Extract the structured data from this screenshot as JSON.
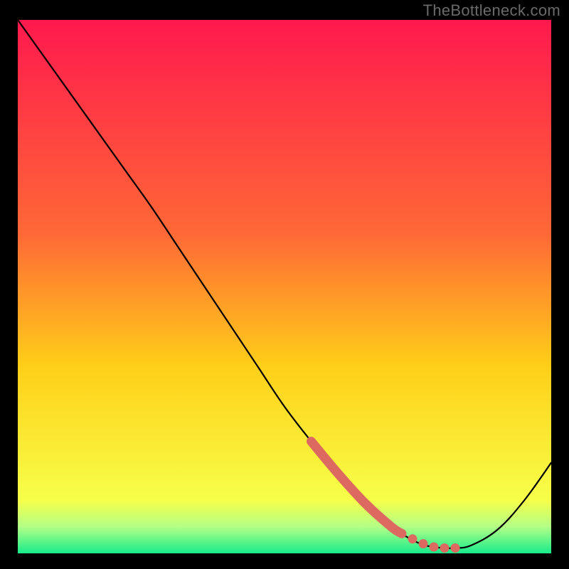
{
  "watermark": "TheBottleneck.com",
  "chart_data": {
    "type": "line",
    "title": "",
    "xlabel": "",
    "ylabel": "",
    "xlim": [
      0,
      100
    ],
    "ylim": [
      0,
      100
    ],
    "x": [
      0,
      5,
      10,
      15,
      20,
      25,
      30,
      35,
      40,
      45,
      50,
      55,
      60,
      65,
      70,
      75,
      78,
      80,
      82,
      85,
      90,
      95,
      100
    ],
    "values": [
      100,
      93,
      86,
      79,
      72,
      65,
      57.5,
      50,
      42.5,
      35,
      27.5,
      21,
      15,
      9.5,
      5,
      2,
      1.2,
      1,
      1,
      1.5,
      4.5,
      10,
      17
    ],
    "highlight": {
      "x": [
        55,
        60,
        65,
        70,
        72,
        74,
        76,
        78,
        80,
        82
      ],
      "values": [
        21,
        15,
        9.5,
        5,
        3.7,
        2.7,
        1.8,
        1.2,
        1,
        1
      ]
    },
    "bands": [
      {
        "name": "red",
        "from": 100,
        "to": 60,
        "color_top": "#ff194e",
        "color_bottom": "#ff6836"
      },
      {
        "name": "orange",
        "from": 60,
        "to": 35,
        "color_top": "#ff6836",
        "color_bottom": "#ffcf18"
      },
      {
        "name": "yellow",
        "from": 35,
        "to": 10,
        "color_top": "#ffcf18",
        "color_bottom": "#f7ff49"
      },
      {
        "name": "yellowgreen",
        "from": 10,
        "to": 5,
        "color_top": "#f7ff49",
        "color_bottom": "#b3ff86"
      },
      {
        "name": "green",
        "from": 5,
        "to": 0,
        "color_top": "#b3ff86",
        "color_bottom": "#18ec8c"
      }
    ]
  }
}
